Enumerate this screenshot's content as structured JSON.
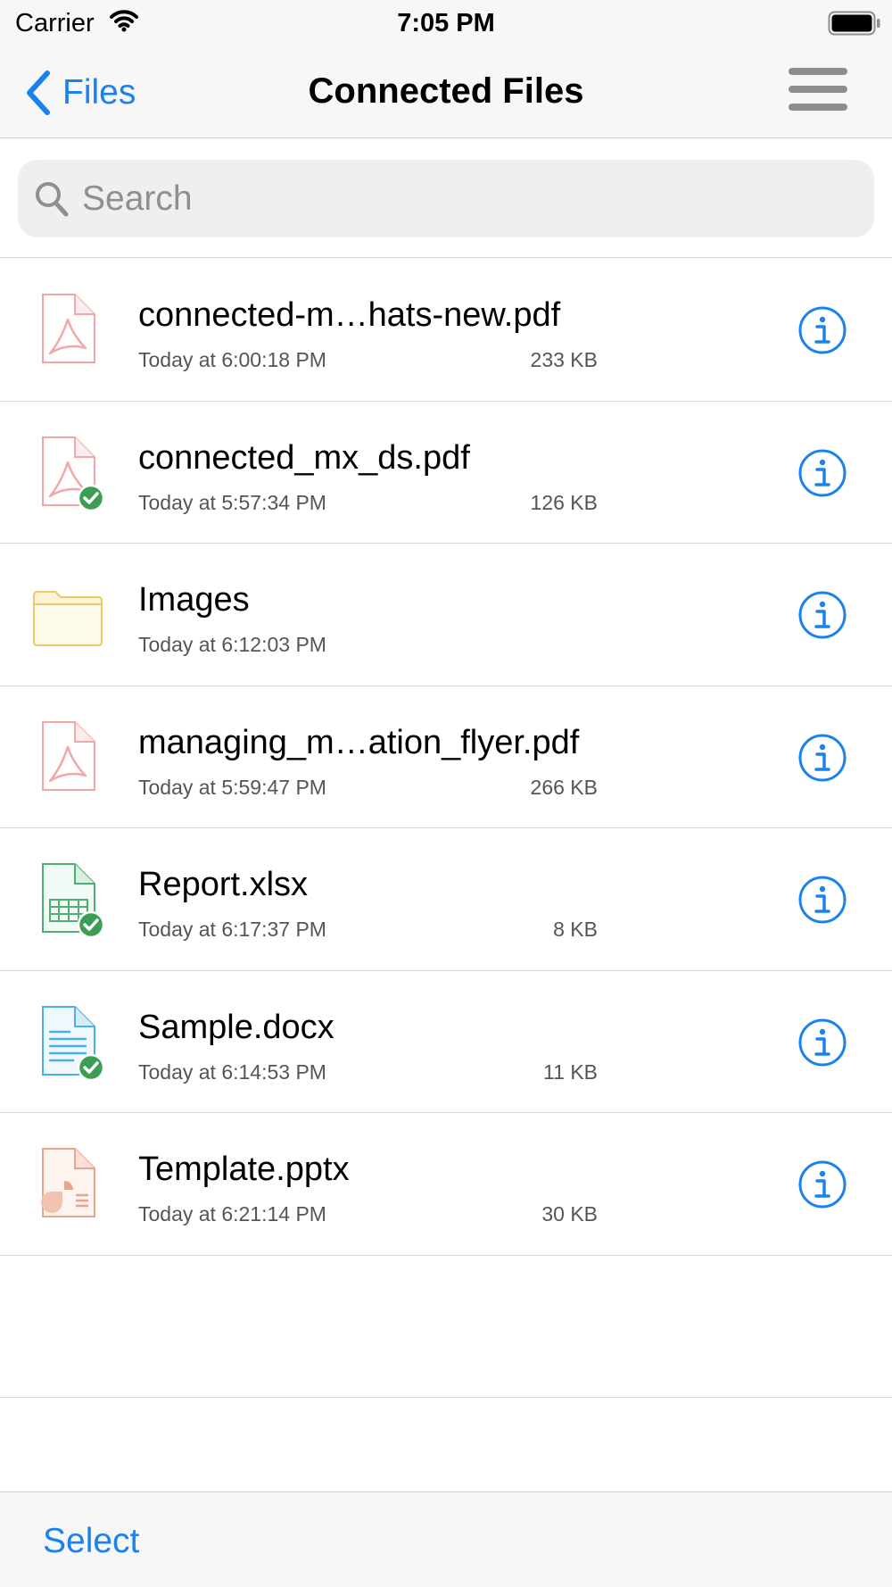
{
  "status_bar": {
    "carrier": "Carrier",
    "time": "7:05 PM"
  },
  "nav": {
    "back_label": "Files",
    "title": "Connected Files"
  },
  "search": {
    "placeholder": "Search",
    "value": ""
  },
  "files": [
    {
      "name": "connected-m…hats-new.pdf",
      "date": "Today at 6:00:18 PM",
      "size": "233 KB",
      "icon": "pdf-file-icon",
      "downloaded": false
    },
    {
      "name": "connected_mx_ds.pdf",
      "date": "Today at 5:57:34 PM",
      "size": "126 KB",
      "icon": "pdf-file-icon",
      "downloaded": true
    },
    {
      "name": "Images",
      "date": "Today at 6:12:03 PM",
      "size": "",
      "icon": "folder-icon",
      "downloaded": false
    },
    {
      "name": "managing_m…ation_flyer.pdf",
      "date": "Today at 5:59:47 PM",
      "size": "266 KB",
      "icon": "pdf-file-icon",
      "downloaded": false
    },
    {
      "name": "Report.xlsx",
      "date": "Today at 6:17:37 PM",
      "size": "8 KB",
      "icon": "spreadsheet-file-icon",
      "downloaded": true
    },
    {
      "name": "Sample.docx",
      "date": "Today at 6:14:53 PM",
      "size": "11 KB",
      "icon": "document-file-icon",
      "downloaded": true
    },
    {
      "name": "Template.pptx",
      "date": "Today at 6:21:14 PM",
      "size": "30 KB",
      "icon": "presentation-file-icon",
      "downloaded": false
    }
  ],
  "toolbar": {
    "select_label": "Select"
  },
  "colors": {
    "accent": "#1a82ee",
    "pdf": "#f2a8a8",
    "folder": "#f0c86a",
    "spreadsheet": "#4fae74",
    "document": "#4ab0df",
    "presentation": "#e8a48c",
    "downloaded_badge": "#3e9d55"
  }
}
